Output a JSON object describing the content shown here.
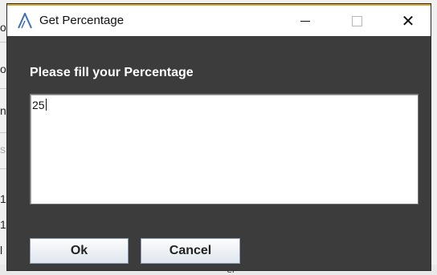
{
  "window": {
    "title": "Get Percentage"
  },
  "titlebar_buttons": {
    "minimize_icon": "minimize-icon",
    "maximize_icon": "maximize-icon",
    "close_icon": "close-icon"
  },
  "form": {
    "prompt": "Please fill your Percentage",
    "value": "25"
  },
  "buttons": {
    "ok": "Ok",
    "cancel": "Cancel"
  },
  "background_app": {
    "fragments": [
      "o",
      "ol",
      "n",
      "sh",
      "1",
      "1",
      "l"
    ],
    "bottom_text": "el"
  },
  "colors": {
    "dialog_bg": "#3c3c3c",
    "titlebar_bg": "#ffffff",
    "accent_border": "#d9a520",
    "app_icon": "#3b6fb6"
  }
}
